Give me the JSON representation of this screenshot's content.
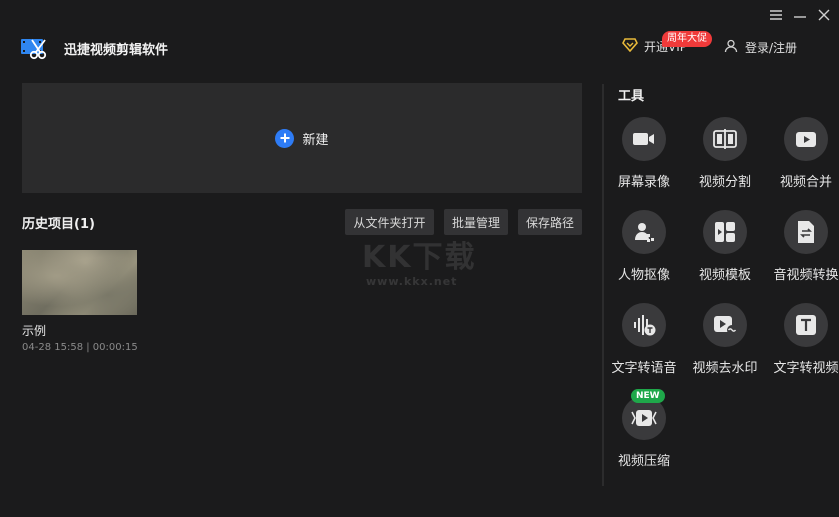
{
  "app": {
    "title": "迅捷视频剪辑软件"
  },
  "window": {
    "menu_icon": "menu-icon",
    "minimize_icon": "minimize-icon",
    "close_icon": "close-icon"
  },
  "header": {
    "vip_label": "开通VIP",
    "promo_badge": "周年大促",
    "login_label": "登录/注册"
  },
  "main": {
    "new_label": "新建",
    "history_title": "历史项目(1)",
    "buttons": [
      "从文件夹打开",
      "批量管理",
      "保存路径"
    ],
    "projects": [
      {
        "name": "示例",
        "meta": "04-28 15:58 | 00:00:15"
      }
    ],
    "watermark": "KK下载",
    "watermark_url": "www.kkx.net"
  },
  "tools": {
    "title": "工具",
    "items": [
      {
        "label": "屏幕录像",
        "icon": "screen-record-icon"
      },
      {
        "label": "视频分割",
        "icon": "video-split-icon"
      },
      {
        "label": "视频合并",
        "icon": "video-merge-icon"
      },
      {
        "label": "人物抠像",
        "icon": "person-cutout-icon"
      },
      {
        "label": "视频模板",
        "icon": "video-template-icon"
      },
      {
        "label": "音视频转换",
        "icon": "av-convert-icon"
      },
      {
        "label": "文字转语音",
        "icon": "text-to-speech-icon"
      },
      {
        "label": "视频去水印",
        "icon": "remove-watermark-icon"
      },
      {
        "label": "文字转视频",
        "icon": "text-to-video-icon"
      },
      {
        "label": "视频压缩",
        "icon": "video-compress-icon",
        "badge": "NEW"
      }
    ]
  },
  "colors": {
    "accent": "#2e7cf6",
    "promo": "#f03a3a",
    "new_badge": "#1fa84a",
    "vip_gold": "#e8b93a"
  }
}
